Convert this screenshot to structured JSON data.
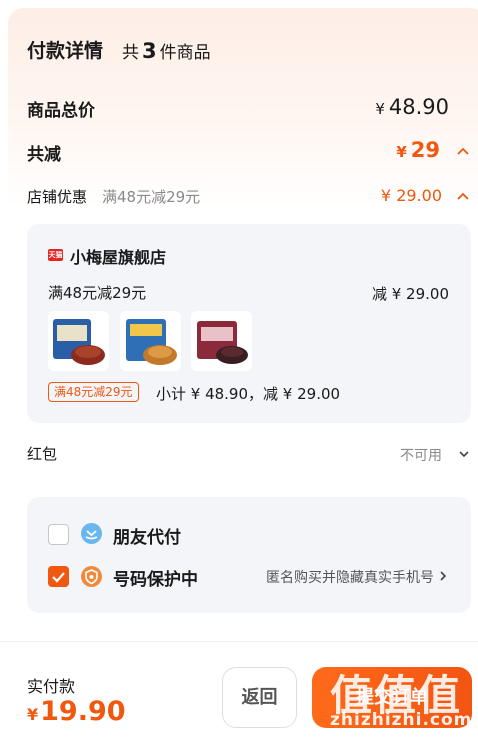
{
  "header": {
    "title": "付款详情",
    "count_prefix": "共",
    "count": "3",
    "count_suffix": "件商品"
  },
  "summary": {
    "total_label": "商品总价",
    "total_yen": "¥",
    "total_value": "48.90",
    "discount_label": "共减",
    "discount_yen": "¥",
    "discount_value": "29",
    "discount_chevron": "^"
  },
  "shop_discount": {
    "label": "店铺优惠",
    "desc": "满48元减29元",
    "amount": "¥ 29.00",
    "chevron": "^"
  },
  "shop": {
    "badge": "天猫",
    "name": "小梅屋旗舰店",
    "promo": "满48元减29元",
    "promo_amount": "减 ¥ 29.00",
    "tag": "满48元减29元",
    "subtotal": "小计 ¥ 48.90，减 ¥ 29.00",
    "products": [
      {
        "name": "product-thumb-1",
        "colors": [
          "#2a5fa8",
          "#8b2a1d"
        ]
      },
      {
        "name": "product-thumb-2",
        "colors": [
          "#2f6fb5",
          "#c27a2a"
        ]
      },
      {
        "name": "product-thumb-3",
        "colors": [
          "#8b2a3a",
          "#3a1f22"
        ]
      }
    ]
  },
  "red_packet": {
    "label": "红包",
    "value": "不可用",
    "chevron": "v"
  },
  "services": {
    "friend_pay": {
      "label": "朋友代付",
      "checked": false,
      "icon": "friend-pay-icon"
    },
    "number_protect": {
      "label": "号码保护中",
      "checked": true,
      "icon": "phone-shield-icon",
      "desc": "匿名购买并隐藏真实手机号",
      "chevron": ">"
    }
  },
  "footer": {
    "pay_label": "实付款",
    "pay_yen": "¥",
    "pay_value": "19.90",
    "back": "返回",
    "pay_button": "提交订单",
    "watermark": "值值值",
    "watermark_url": "zhizhizhi.com"
  },
  "colors": {
    "accent": "#f0570f",
    "panel": "#f3f5f8"
  }
}
